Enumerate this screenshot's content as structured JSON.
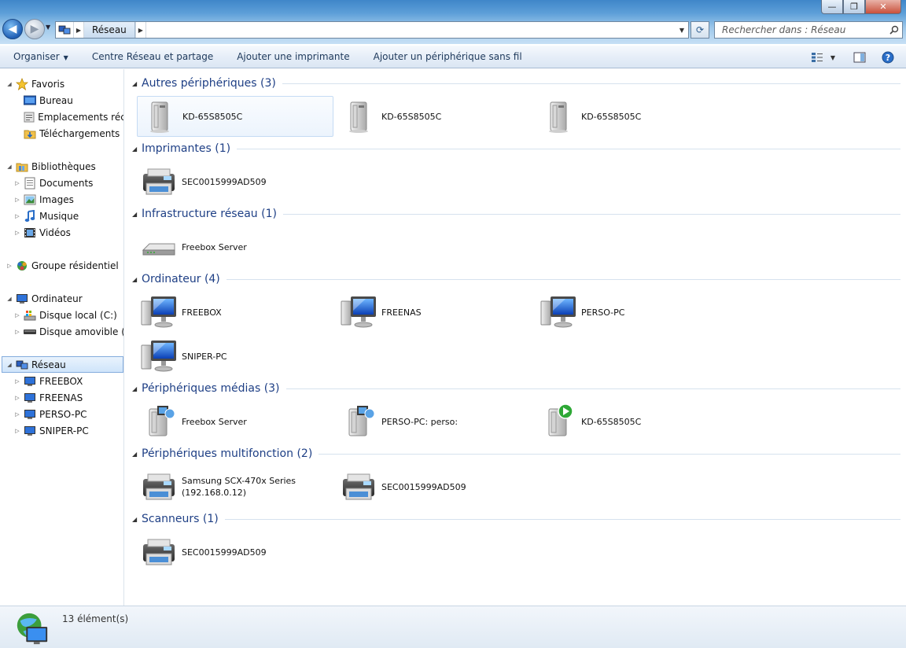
{
  "window": {
    "minimize_glyph": "—",
    "maximize_glyph": "❐",
    "close_glyph": "✕"
  },
  "address": {
    "crumb": "Réseau",
    "search_placeholder": "Rechercher dans : Réseau"
  },
  "commandbar": {
    "organize": "Organiser",
    "network_center": "Centre Réseau et partage",
    "add_printer": "Ajouter une imprimante",
    "add_wireless": "Ajouter un périphérique sans fil"
  },
  "sidebar": {
    "favorites": "Favoris",
    "desktop": "Bureau",
    "recent": "Emplacements récents",
    "downloads": "Téléchargements",
    "libraries": "Bibliothèques",
    "documents": "Documents",
    "images": "Images",
    "music": "Musique",
    "videos": "Vidéos",
    "homegroup": "Groupe résidentiel",
    "computer": "Ordinateur",
    "local_disk": "Disque local (C:)",
    "removable": "Disque amovible (J:)",
    "network": "Réseau",
    "net_items": [
      "FREEBOX",
      "FREENAS",
      "PERSO-PC",
      "SNIPER-PC"
    ]
  },
  "groups": [
    {
      "title": "Autres périphériques (3)",
      "items": [
        "KD-65S8505C",
        "KD-65S8505C",
        "KD-65S8505C"
      ]
    },
    {
      "title": "Imprimantes (1)",
      "items": [
        "SEC0015999AD509"
      ]
    },
    {
      "title": "Infrastructure réseau (1)",
      "items": [
        "Freebox Server"
      ]
    },
    {
      "title": "Ordinateur (4)",
      "items": [
        "FREEBOX",
        "FREENAS",
        "PERSO-PC",
        "SNIPER-PC"
      ]
    },
    {
      "title": "Périphériques médias (3)",
      "items": [
        "Freebox Server",
        "PERSO-PC: perso:",
        "KD-65S8505C"
      ]
    },
    {
      "title": "Périphériques multifonction (2)",
      "items": [
        "Samsung SCX-470x Series",
        "SEC0015999AD509"
      ],
      "item0_line2": "(192.168.0.12)"
    },
    {
      "title": "Scanneurs (1)",
      "items": [
        "SEC0015999AD509"
      ]
    }
  ],
  "status": {
    "count": "13 élément(s)"
  }
}
